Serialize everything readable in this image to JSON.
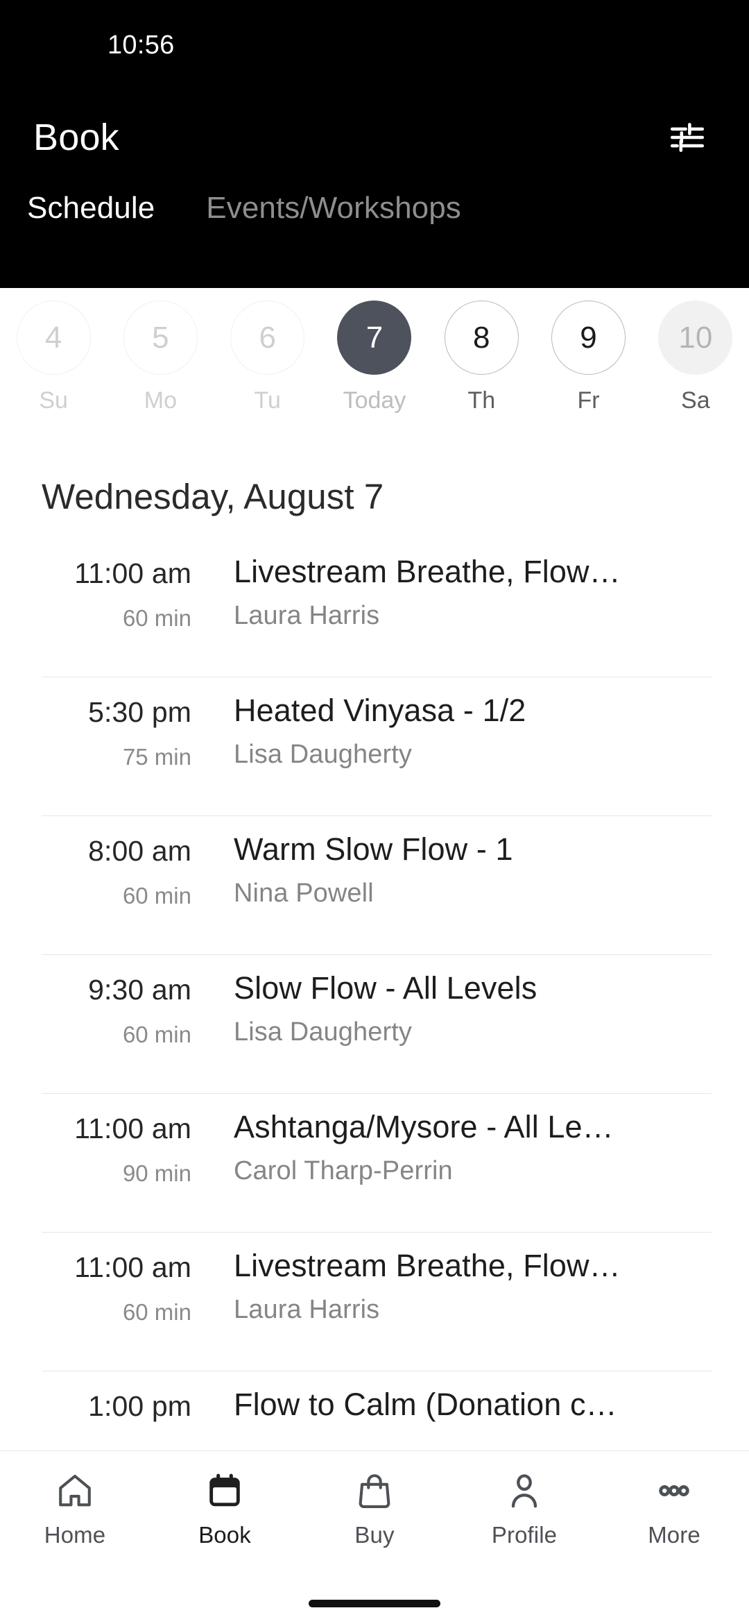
{
  "status_bar": {
    "time": "10:56"
  },
  "header": {
    "title": "Book",
    "filter_icon": "tune-filter-icon",
    "tabs": [
      {
        "label": "Schedule",
        "active": true
      },
      {
        "label": "Events/Workshops",
        "active": false
      }
    ]
  },
  "date_strip": {
    "days": [
      {
        "number": "4",
        "label": "Su",
        "state": "past"
      },
      {
        "number": "5",
        "label": "Mo",
        "state": "past"
      },
      {
        "number": "6",
        "label": "Tu",
        "state": "past"
      },
      {
        "number": "7",
        "label": "Today",
        "state": "selected"
      },
      {
        "number": "8",
        "label": "Th",
        "state": "available"
      },
      {
        "number": "9",
        "label": "Fr",
        "state": "available"
      },
      {
        "number": "10",
        "label": "Sa",
        "state": "filled"
      }
    ]
  },
  "schedule": {
    "date_heading": "Wednesday, August 7",
    "classes": [
      {
        "time": "11:00 am",
        "duration": "60 min",
        "title": "Livestream Breathe, Flow…",
        "teacher": "Laura Harris"
      },
      {
        "time": "5:30 pm",
        "duration": "75 min",
        "title": "Heated Vinyasa - 1/2",
        "teacher": "Lisa Daugherty"
      },
      {
        "time": "8:00 am",
        "duration": "60 min",
        "title": "Warm Slow Flow - 1",
        "teacher": "Nina Powell"
      },
      {
        "time": "9:30 am",
        "duration": "60 min",
        "title": "Slow Flow - All Levels",
        "teacher": "Lisa Daugherty"
      },
      {
        "time": "11:00 am",
        "duration": "90 min",
        "title": "Ashtanga/Mysore - All Le…",
        "teacher": "Carol Tharp-Perrin"
      },
      {
        "time": "11:00 am",
        "duration": "60 min",
        "title": "Livestream Breathe, Flow…",
        "teacher": "Laura Harris"
      },
      {
        "time": "1:00 pm",
        "duration": "",
        "title": "Flow to Calm (Donation c…",
        "teacher": ""
      }
    ]
  },
  "bottom_nav": {
    "items": [
      {
        "label": "Home",
        "icon": "home-icon",
        "active": false
      },
      {
        "label": "Book",
        "icon": "calendar-icon",
        "active": true
      },
      {
        "label": "Buy",
        "icon": "shopping-bag-icon",
        "active": false
      },
      {
        "label": "Profile",
        "icon": "person-icon",
        "active": false
      },
      {
        "label": "More",
        "icon": "more-dots-icon",
        "active": false
      }
    ]
  },
  "colors": {
    "header_bg": "#000000",
    "selected_day": "#4e525c",
    "page_bg": "#ffffff",
    "divider": "#e6e6e6",
    "muted_text": "#8a8a8a"
  }
}
